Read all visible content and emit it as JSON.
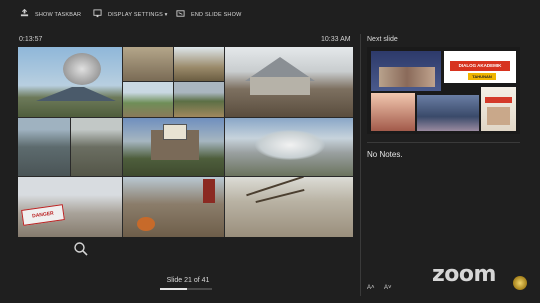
{
  "toolbar": {
    "show_taskbar": "SHOW TASKBAR",
    "display_settings": "DISPLAY SETTINGS ▾",
    "end_slide_show": "END SLIDE SHOW"
  },
  "presenter": {
    "elapsed": "0:13:57",
    "clock": "10:33 AM",
    "slide_counter": "Slide 21 of 41",
    "progress": 0.51,
    "next_slide_label": "Next slide",
    "notes": "No Notes."
  },
  "current_slide": {
    "sign_text": "DANGER"
  },
  "next_slide": {
    "banner_text": "DIALOG AKADEMIK",
    "subtitle": "TAHUNAN"
  },
  "font_controls": {
    "increase": "A˄",
    "decrease": "A˅"
  },
  "branding": {
    "logo_text": "zoom"
  },
  "colors": {
    "background": "#1f1f1f",
    "accent": "#e6e6e6"
  },
  "icons": [
    "taskbar-icon",
    "display-settings-icon",
    "end-show-icon",
    "zoom-magnifier-icon",
    "meeting-badge-icon"
  ]
}
